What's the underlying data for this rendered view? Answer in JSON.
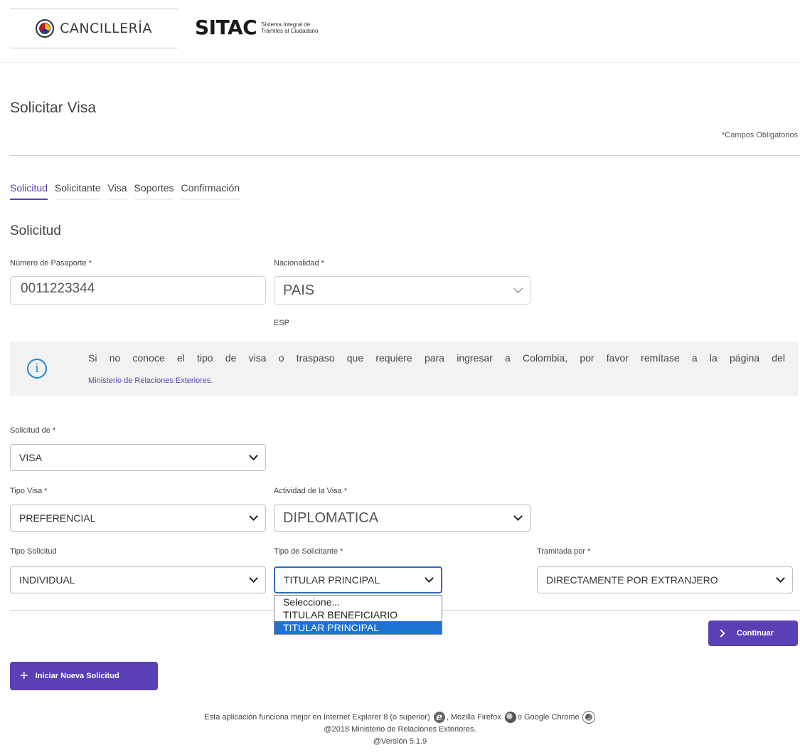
{
  "header": {
    "brand_name": "CANCILLERÍA",
    "sitac_logo": "SITAC",
    "sitac_subtitle": "Sistema Integral de Trámites al Ciudadano"
  },
  "page": {
    "title": "Solicitar Visa",
    "required_note": "*Campos Obligatorios"
  },
  "tabs": [
    {
      "label": "Solicitud",
      "active": true
    },
    {
      "label": "Solicitante",
      "active": false
    },
    {
      "label": "Visa",
      "active": false
    },
    {
      "label": "Soportes",
      "active": false
    },
    {
      "label": "Confirmación",
      "active": false
    }
  ],
  "section": {
    "title": "Solicitud"
  },
  "fields": {
    "passport": {
      "label": "Número de Pasaporte *",
      "value": "0011223344"
    },
    "nationality": {
      "label": "Nacionalidad *",
      "value": "PAIS",
      "code": "ESP"
    },
    "request_of": {
      "label": "Solicitud de *",
      "value": "VISA"
    },
    "visa_type": {
      "label": "Tipo Visa *",
      "value": "PREFERENCIAL"
    },
    "visa_activity": {
      "label": "Actividad de la Visa *",
      "value": "DIPLOMATICA"
    },
    "request_type": {
      "label": "Tipo Solicitud",
      "value": "INDIVIDUAL"
    },
    "applicant_type": {
      "label": "Tipo de Solicitante *",
      "value": "TITULAR PRINCIPAL",
      "options": [
        "Seleccione...",
        "TITULAR BENEFICIARIO",
        "TITULAR PRINCIPAL"
      ]
    },
    "processed_by": {
      "label": "Tramitada por *",
      "value": "DIRECTAMENTE POR EXTRANJERO"
    }
  },
  "info": {
    "text": "Si no conoce el tipo de visa o traspaso que requiere para ingresar a Colombia, por favor remítase a la página del",
    "link": "Ministerio de Relaciones Exteriores."
  },
  "buttons": {
    "continue": "Continuar",
    "new_request": "Iniciar Nueva Solicitud"
  },
  "footer": {
    "line1_a": "Esta aplicación funciona mejor en Internet Explorer 8 (o superior)",
    "line1_b": ", Mozilla Firefox",
    "line1_c": "o Google Chrome",
    "line2": "@2018 Ministerio de Relaciones Exteriores.",
    "line3": "@Versión 5.1.9"
  },
  "colors": {
    "accent": "#5b3fb5",
    "info_icon": "#1f88d8",
    "selected_option": "#1e73d2"
  }
}
